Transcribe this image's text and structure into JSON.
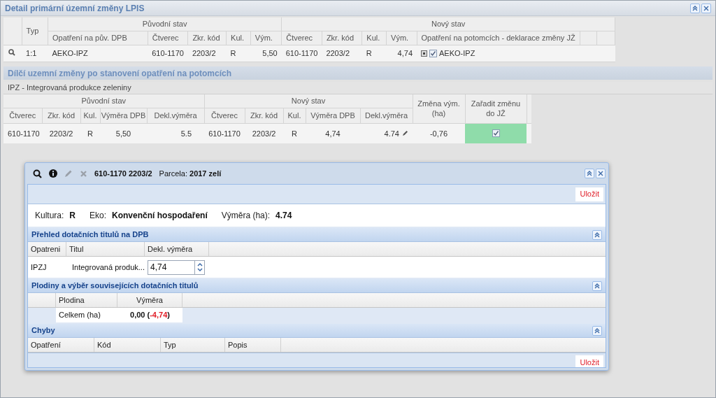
{
  "window": {
    "title": "Detail primární územní změny LPIS"
  },
  "main_table": {
    "groups": [
      "Původní stav",
      "Nový stav"
    ],
    "columns": [
      "Typ",
      "Opatření na pův. DPB",
      "Čtverec",
      "Zkr. kód",
      "Kul.",
      "Vým.",
      "Čtverec",
      "Zkr. kód",
      "Kul.",
      "Vým.",
      "Opatření na potomcích - deklarace změny JŽ"
    ],
    "rows": [
      {
        "cells": [
          "1:1",
          "AEKO-IPZ",
          "610-1170",
          "2203/2",
          "R",
          "5,50",
          "610-1170",
          "2203/2",
          "R",
          "4,74"
        ],
        "measure": {
          "expanded": false,
          "checked": true,
          "label": "AEKO-IPZ"
        }
      }
    ]
  },
  "sub_section": {
    "title": "Dílčí uzemní změny po stanovení opatření na potomcích",
    "group_title": "IPZ - Integrovaná produkce zeleniny"
  },
  "sub_table": {
    "groups": [
      "Původní stav",
      "Nový stav"
    ],
    "change_header": "Změna vým. (ha)",
    "include_header": "Zařadit změnu do JŽ",
    "columns": [
      "Čtverec",
      "Zkr. kód",
      "Kul.",
      "Výměra DPB",
      "Dekl.výměra",
      "Čtverec",
      "Zkr. kód",
      "Kul.",
      "Výměra DPB",
      "Dekl.výměra"
    ],
    "rows": [
      {
        "cells": [
          "610-1170",
          "2203/2",
          "R",
          "5,50",
          "5.5",
          "610-1170",
          "2203/2",
          "R",
          "4,74",
          "4.74"
        ],
        "change": "-0,76",
        "checked": true
      }
    ]
  },
  "dialog": {
    "tools": [
      {
        "kind": "search",
        "disabled": false
      },
      {
        "kind": "info",
        "disabled": false
      },
      {
        "kind": "edit",
        "disabled": true
      },
      {
        "kind": "delete",
        "disabled": true
      }
    ],
    "title": "610-1170 2203/2",
    "parcel_label": "Parcela:",
    "parcel_value": "2017 zelí",
    "save_top": "Uložit",
    "save_bottom": "Uložit",
    "info": [
      {
        "label": "Kultura:",
        "value": "R"
      },
      {
        "label": "Eko:",
        "value": "Konvenční hospodaření"
      },
      {
        "label": "Výměra (ha):",
        "value": "4.74"
      }
    ],
    "sections": [
      {
        "kind": "titles",
        "title": "Přehled dotačních titulů na DPB",
        "expanded": true,
        "columns": [
          "Opatreni",
          "Titul",
          "Dekl. výměra"
        ],
        "rows": [
          [
            {
              "kind": "text",
              "text": "IPZJ"
            },
            {
              "kind": "text",
              "text": "Integrovaná produk..."
            },
            {
              "kind": "input",
              "value": "4,74"
            }
          ]
        ]
      },
      {
        "kind": "crops",
        "title": "Plodiny a výběr souvisejících dotačních titulů",
        "expanded": true,
        "columns": [
          "Plodina",
          "Výměra"
        ],
        "rows": [
          [
            {
              "kind": "text",
              "text": "Celkem (ha)"
            },
            {
              "kind": "total",
              "parts": [
                {
                  "text": "0,00 (",
                  "negative": false
                },
                {
                  "text": "-4,74",
                  "negative": true
                },
                {
                  "text": ")",
                  "negative": false
                }
              ]
            }
          ]
        ]
      },
      {
        "kind": "errors",
        "title": "Chyby",
        "expanded": true,
        "columns": [
          "Opatření",
          "Kód",
          "Typ",
          "Popis"
        ]
      }
    ]
  }
}
